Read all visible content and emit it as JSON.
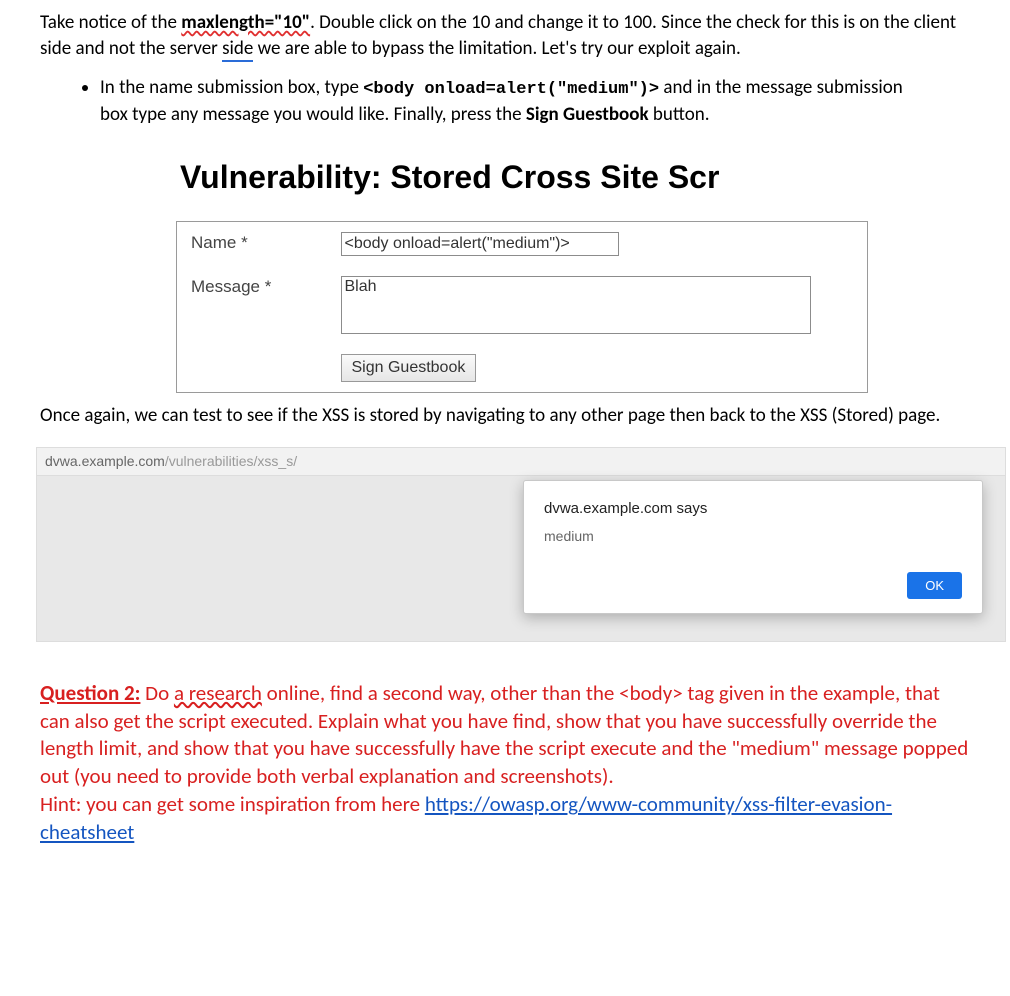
{
  "intro": {
    "pre_ml": "Take notice of the ",
    "ml_text": "maxlength=\"10\"",
    "pre_side": ". Double click on the 10 and change it to 100. Since the check for this is on the client side and not the server ",
    "side": "side",
    "post_side": " we are able to bypass the limitation. Let's try our exploit again."
  },
  "bullet": {
    "pre_code": "In the name submission box, type ",
    "code": "<body onload=alert(\"medium\")>",
    "mid": " and in the message submission box type any message you would like. Finally, press the ",
    "sign_bold": "Sign Guestbook",
    "post": " button."
  },
  "dvwa": {
    "title": "Vulnerability: Stored Cross Site Scr",
    "name_label": "Name *",
    "name_value": "<body onload=alert(\"medium\")>",
    "message_label": "Message *",
    "message_value": "Blah",
    "sign_button": "Sign Guestbook"
  },
  "para2": "Once again, we can test to see if the XSS is stored by navigating to any other page then back to the XSS (Stored) page.",
  "alert": {
    "url_host": "dvwa.example.com",
    "url_path": "/vulnerabilities/xss_s/",
    "who": "dvwa.example.com says",
    "message": "medium",
    "ok": "OK"
  },
  "question": {
    "label": "Question 2:",
    "pre_research": " Do ",
    "research": "a research",
    "body1": " online, find a second way, other than the <body> tag given in the example, that can also get the script executed. Explain what you have find, show that you have successfully override the length limit, and show that you have successfully have the script execute and the \"medium\" message popped out (you need to provide both verbal explanation and screenshots).",
    "hint_pre": "Hint: you can get some inspiration from here ",
    "hint_link": "https://owasp.org/www-community/xss-filter-evasion-cheatsheet"
  }
}
